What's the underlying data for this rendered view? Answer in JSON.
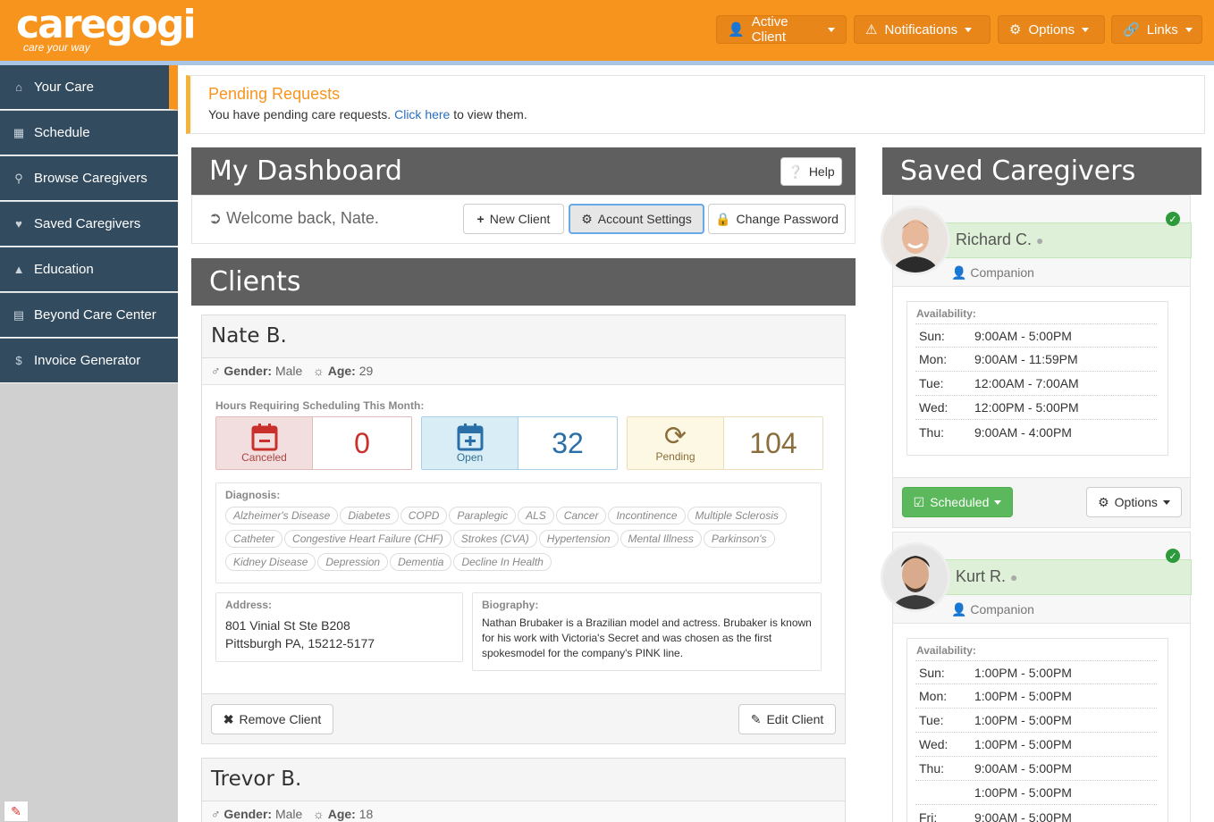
{
  "header": {
    "logo": "caregogi",
    "tagline": "care your way",
    "buttons": [
      {
        "label": "Active Client",
        "icon": "user-icon"
      },
      {
        "label": "Notifications",
        "icon": "warning-icon"
      },
      {
        "label": "Options",
        "icon": "gear-icon"
      },
      {
        "label": "Links",
        "icon": "link-icon"
      }
    ]
  },
  "sidebar": {
    "items": [
      {
        "label": "Your Care",
        "icon": "home-icon"
      },
      {
        "label": "Schedule",
        "icon": "calendar-icon"
      },
      {
        "label": "Browse Caregivers",
        "icon": "search-icon"
      },
      {
        "label": "Saved Caregivers",
        "icon": "heart-icon"
      },
      {
        "label": "Education",
        "icon": "graduation-cap-icon"
      },
      {
        "label": "Beyond Care Center",
        "icon": "book-icon"
      },
      {
        "label": "Invoice Generator",
        "icon": "dollar-icon"
      }
    ]
  },
  "pending": {
    "title": "Pending Requests",
    "text_before": "You have pending care requests. ",
    "link": "Click here",
    "text_after": " to view them."
  },
  "dashboard": {
    "title": "My Dashboard",
    "help": "Help",
    "welcome": "Welcome back, Nate.",
    "new_client": "New Client",
    "account_settings": "Account Settings",
    "change_password": "Change Password"
  },
  "clients": {
    "title": "Clients",
    "hours_label": "Hours Requiring Scheduling This Month:",
    "list": [
      {
        "name": "Nate B.",
        "gender_label": "Gender:",
        "gender": "Male",
        "age_label": "Age:",
        "age": "29",
        "stats": [
          {
            "label": "Canceled",
            "value": "0"
          },
          {
            "label": "Open",
            "value": "32"
          },
          {
            "label": "Pending",
            "value": "104"
          }
        ],
        "diagnosis_label": "Diagnosis:",
        "diagnosis": [
          "Alzheimer's Disease",
          "Diabetes",
          "COPD",
          "Paraplegic",
          "ALS",
          "Cancer",
          "Incontinence",
          "Multiple Sclerosis",
          "Catheter",
          "Congestive Heart Failure (CHF)",
          "Strokes (CVA)",
          "Hypertension",
          "Mental Illness",
          "Parkinson's",
          "Kidney Disease",
          "Depression",
          "Dementia",
          "Decline In Health"
        ],
        "address_label": "Address:",
        "address_line1": "801 Vinial St Ste B208",
        "address_line2": "Pittsburgh PA, 15212-5177",
        "bio_label": "Biography:",
        "bio": "Nathan Brubaker is a Brazilian model and actress. Brubaker is known for his work with Victoria's Secret and was chosen as the first spokesmodel for the company's PINK line.",
        "remove": "Remove Client",
        "edit": "Edit Client"
      },
      {
        "name": "Trevor B.",
        "gender_label": "Gender:",
        "gender": "Male",
        "age_label": "Age:",
        "age": "18"
      }
    ]
  },
  "saved": {
    "title": "Saved Caregivers",
    "availability_label": "Availability:",
    "caregivers": [
      {
        "name": "Richard C.",
        "role": "Companion",
        "availability": [
          {
            "day": "Sun:",
            "time": "9:00AM - 5:00PM"
          },
          {
            "day": "Mon:",
            "time": "9:00AM - 11:59PM"
          },
          {
            "day": "Tue:",
            "time": "12:00AM - 7:00AM"
          },
          {
            "day": "Wed:",
            "time": "12:00PM - 5:00PM"
          },
          {
            "day": "Thu:",
            "time": "9:00AM - 4:00PM"
          }
        ],
        "scheduled": "Scheduled",
        "options": "Options"
      },
      {
        "name": "Kurt R.",
        "role": "Companion",
        "availability": [
          {
            "day": "Sun:",
            "time": "1:00PM - 5:00PM"
          },
          {
            "day": "Mon:",
            "time": "1:00PM - 5:00PM"
          },
          {
            "day": "Tue:",
            "time": "1:00PM - 5:00PM"
          },
          {
            "day": "Wed:",
            "time": "1:00PM - 5:00PM"
          },
          {
            "day": "Thu:",
            "time": "9:00AM - 5:00PM"
          },
          {
            "day": "",
            "time": "1:00PM - 5:00PM"
          },
          {
            "day": "Fri:",
            "time": "9:00AM - 5:00PM"
          }
        ]
      }
    ]
  },
  "colors": {
    "brand_orange": "#f7941e",
    "sidebar": "#324b5f",
    "canceled": "#c9302c",
    "open": "#2a6fa8",
    "pending": "#8a6d3b",
    "success": "#5cb85c"
  }
}
